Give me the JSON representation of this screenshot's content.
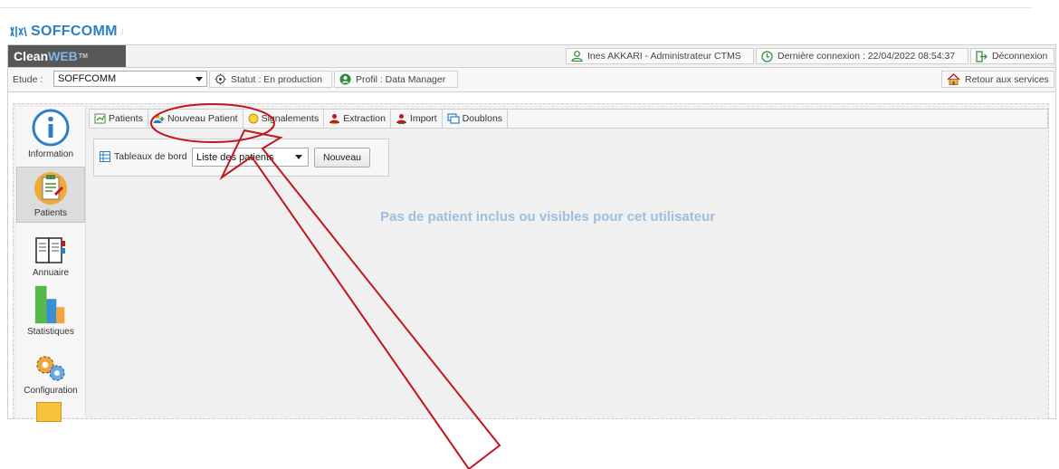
{
  "brand": {
    "name": "SOFFCOMM"
  },
  "header": {
    "logo_main": "Clean",
    "logo_accent": "WEB",
    "logo_tm": "TM",
    "user": "Ines AKKARI - Administrateur CTMS",
    "last_login": "Dernière connexion : 22/04/2022 08:54:37",
    "logout": "Déconnexion"
  },
  "study_bar": {
    "label": "Etude :",
    "study_value": "SOFFCOMM",
    "status": "Statut : En production",
    "profile": "Profil : Data Manager",
    "back": "Retour aux services"
  },
  "sidebar": {
    "items": [
      {
        "label": "Information",
        "icon": "info-icon"
      },
      {
        "label": "Patients",
        "icon": "patients-icon",
        "active": true
      },
      {
        "label": "Annuaire",
        "icon": "directory-book-icon"
      },
      {
        "label": "Statistiques",
        "icon": "bar-chart-icon"
      },
      {
        "label": "Configuration",
        "icon": "gears-icon"
      }
    ]
  },
  "tabs": [
    {
      "label": "Patients",
      "icon": "patients-tab-icon"
    },
    {
      "label": "Nouveau Patient",
      "icon": "new-patient-icon"
    },
    {
      "label": "Signalements",
      "icon": "alert-icon"
    },
    {
      "label": "Extraction",
      "icon": "extraction-icon"
    },
    {
      "label": "Import",
      "icon": "import-icon"
    },
    {
      "label": "Doublons",
      "icon": "duplicates-icon"
    }
  ],
  "dashboard": {
    "label": "Tableaux de bord",
    "selected": "Liste des patients",
    "new_button": "Nouveau"
  },
  "message": "Pas de patient inclus ou visibles pour cet utilisateur",
  "colors": {
    "brand_blue": "#2b7fc4",
    "annotation_red": "#c0171e",
    "message_blue": "#9bbfe0"
  }
}
